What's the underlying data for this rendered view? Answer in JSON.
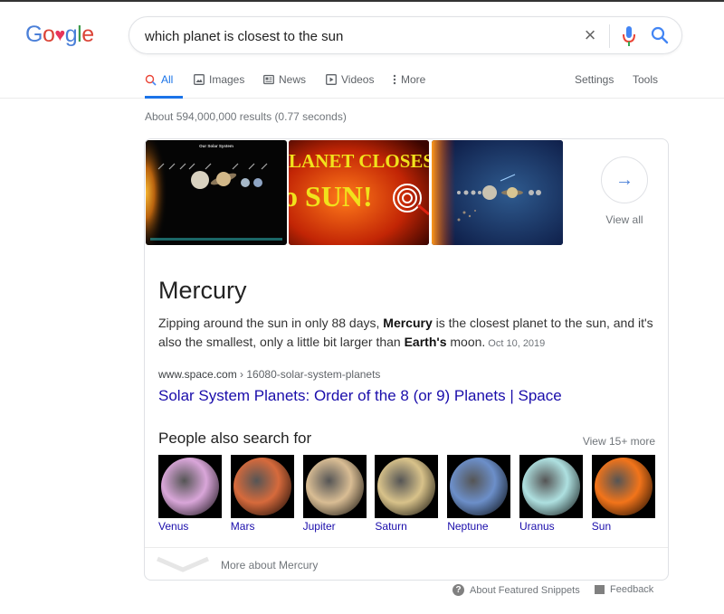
{
  "logo": {
    "text_parts": [
      "G",
      "o",
      "♥",
      "g",
      "l",
      "e"
    ],
    "alt": "Google"
  },
  "search": {
    "query": "which planet is closest to the sun",
    "clear_icon": "close-icon",
    "mic_icon": "microphone-icon",
    "search_icon": "search-icon"
  },
  "tabs": [
    {
      "label": "All",
      "icon": "search-icon",
      "active": true
    },
    {
      "label": "Images",
      "icon": "image-icon"
    },
    {
      "label": "News",
      "icon": "newspaper-icon"
    },
    {
      "label": "Videos",
      "icon": "play-icon"
    },
    {
      "label": "More",
      "icon": "more-vert-icon"
    }
  ],
  "tools": {
    "settings": "Settings",
    "tools": "Tools"
  },
  "stats": "About 594,000,000 results (0.77 seconds)",
  "images": {
    "items": [
      {
        "alt": "Our Solar System",
        "caption": "Our Solar System"
      },
      {
        "alt": "Planet closest to sun",
        "caption": "LANET CLOSES",
        "caption2": "o SUN!"
      },
      {
        "alt": "Solar system planets in a row"
      }
    ],
    "view_all": "View all"
  },
  "featured": {
    "title": "Mercury",
    "snippet_parts": {
      "p1": "Zipping around the sun in only 88 days, ",
      "b1": "Mercury",
      "p2": " is the closest planet to the sun, and it's also the smallest, only a little bit larger than ",
      "b2": "Earth's",
      "p3": " moon."
    },
    "date": "Oct 10, 2019",
    "cite_domain": "www.space.com",
    "cite_path": " › 16080-solar-system-planets",
    "link_title": "Solar System Planets: Order of the 8 (or 9) Planets | Space"
  },
  "people_also_search": {
    "title": "People also search for",
    "view_more": "View 15+ more",
    "items": [
      {
        "label": "Venus",
        "color": "#d9a6d9"
      },
      {
        "label": "Mars",
        "color": "#d66a3c"
      },
      {
        "label": "Jupiter",
        "color": "#d9bd94"
      },
      {
        "label": "Saturn",
        "color": "#d8c28a"
      },
      {
        "label": "Neptune",
        "color": "#6c8fc9"
      },
      {
        "label": "Uranus",
        "color": "#aee0e0"
      },
      {
        "label": "Sun",
        "color": "#f2741a"
      }
    ]
  },
  "more_about": "More about Mercury",
  "footer": {
    "about_snippets": "About Featured Snippets",
    "feedback": "Feedback"
  }
}
